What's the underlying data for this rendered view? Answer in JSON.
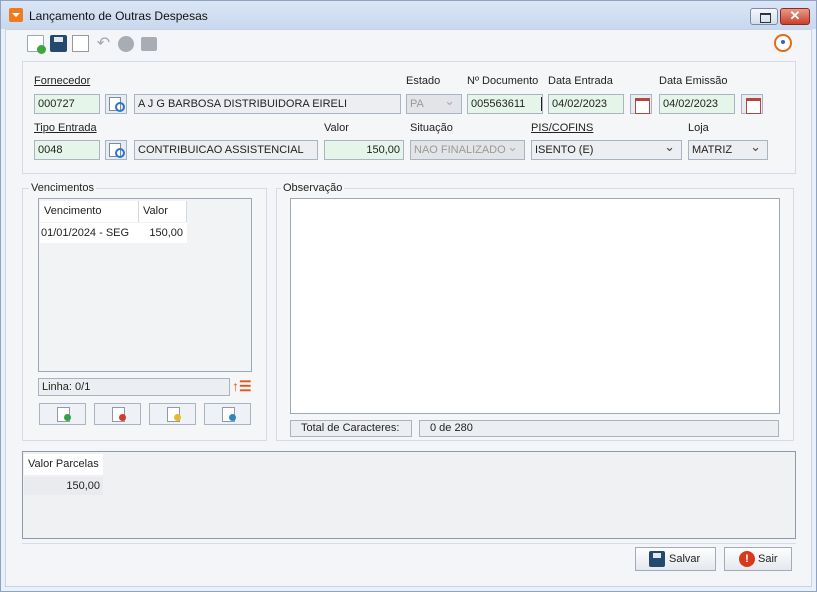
{
  "window": {
    "title": "Lançamento de Outras Despesas"
  },
  "header": {
    "fornecedor_label": "Fornecedor",
    "fornecedor_code": "000727",
    "fornecedor_name": "A J G BARBOSA DISTRIBUIDORA EIRELI",
    "estado_label": "Estado",
    "estado_value": "PA",
    "documento_label": "Nº Documento",
    "documento_value": "005563611",
    "data_entrada_label": "Data Entrada",
    "data_entrada_value": "04/02/2023",
    "data_emissao_label": "Data Emissão",
    "data_emissao_value": "04/02/2023",
    "tipo_entrada_label": "Tipo Entrada",
    "tipo_entrada_code": "0048",
    "tipo_entrada_name": "CONTRIBUICAO ASSISTENCIAL",
    "valor_label": "Valor",
    "valor_value": "150,00",
    "situacao_label": "Situação",
    "situacao_value": "NAO FINALIZADO",
    "pis_cofins_label": "PIS/COFINS",
    "pis_cofins_value": "ISENTO (E)",
    "loja_label": "Loja",
    "loja_value": "MATRIZ"
  },
  "vencimentos": {
    "title": "Vencimentos",
    "columns": [
      "Vencimento",
      "Valor"
    ],
    "rows": [
      {
        "vencimento": "01/01/2024 - SEG",
        "valor": "150,00"
      }
    ],
    "linha": "Linha: 0/1"
  },
  "observacao": {
    "title": "Observação",
    "total_label": "Total de Caracteres:",
    "total_value": "0 de 280"
  },
  "parcelas": {
    "column": "Valor Parcelas",
    "value": "150,00"
  },
  "footer": {
    "save_label": "Salvar",
    "exit_label": "Sair"
  },
  "colors": {
    "accent_orange": "#f07b1e",
    "window_border": "#8ea2c2",
    "field_green": "#e6f5ea"
  }
}
